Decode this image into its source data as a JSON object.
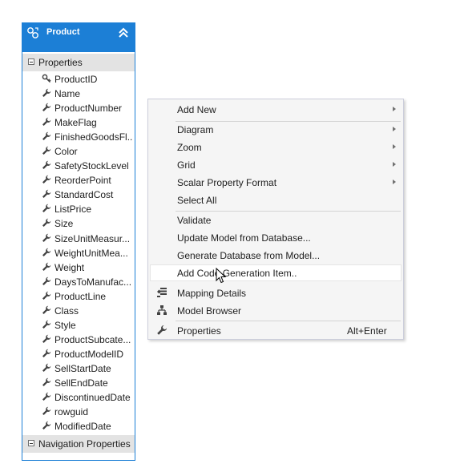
{
  "entity": {
    "title": "Product",
    "sections": {
      "properties": "Properties",
      "navigation": "Navigation Properties"
    },
    "properties": [
      {
        "label": "ProductID",
        "icon": "key-icon"
      },
      {
        "label": "Name",
        "icon": "wrench-icon"
      },
      {
        "label": "ProductNumber",
        "icon": "wrench-icon"
      },
      {
        "label": "MakeFlag",
        "icon": "wrench-icon"
      },
      {
        "label": "FinishedGoodsFl...",
        "icon": "wrench-icon"
      },
      {
        "label": "Color",
        "icon": "wrench-icon"
      },
      {
        "label": "SafetyStockLevel",
        "icon": "wrench-icon"
      },
      {
        "label": "ReorderPoint",
        "icon": "wrench-icon"
      },
      {
        "label": "StandardCost",
        "icon": "wrench-icon"
      },
      {
        "label": "ListPrice",
        "icon": "wrench-icon"
      },
      {
        "label": "Size",
        "icon": "wrench-icon"
      },
      {
        "label": "SizeUnitMeasur...",
        "icon": "wrench-icon"
      },
      {
        "label": "WeightUnitMea...",
        "icon": "wrench-icon"
      },
      {
        "label": "Weight",
        "icon": "wrench-icon"
      },
      {
        "label": "DaysToManufac...",
        "icon": "wrench-icon"
      },
      {
        "label": "ProductLine",
        "icon": "wrench-icon"
      },
      {
        "label": "Class",
        "icon": "wrench-icon"
      },
      {
        "label": "Style",
        "icon": "wrench-icon"
      },
      {
        "label": "ProductSubcate...",
        "icon": "wrench-icon"
      },
      {
        "label": "ProductModelID",
        "icon": "wrench-icon"
      },
      {
        "label": "SellStartDate",
        "icon": "wrench-icon"
      },
      {
        "label": "SellEndDate",
        "icon": "wrench-icon"
      },
      {
        "label": "DiscontinuedDate",
        "icon": "wrench-icon"
      },
      {
        "label": "rowguid",
        "icon": "wrench-icon"
      },
      {
        "label": "ModifiedDate",
        "icon": "wrench-icon"
      }
    ]
  },
  "context_menu": {
    "items": {
      "add_new": "Add New",
      "diagram": "Diagram",
      "zoom": "Zoom",
      "grid": "Grid",
      "scalar_property_format": "Scalar Property Format",
      "select_all": "Select All",
      "validate": "Validate",
      "update_model": "Update Model from Database...",
      "generate_database": "Generate Database from Model...",
      "add_code_generation": "Add Code Generation Item..",
      "mapping_details": "Mapping Details",
      "model_browser": "Model Browser",
      "properties": "Properties"
    },
    "shortcuts": {
      "properties": "Alt+Enter"
    },
    "hovered_item": "Add Code Generation Item.."
  },
  "colors": {
    "header_blue": "#1c7fd6",
    "menu_background": "#f5f5f5",
    "section_background": "#e3e3e3"
  }
}
